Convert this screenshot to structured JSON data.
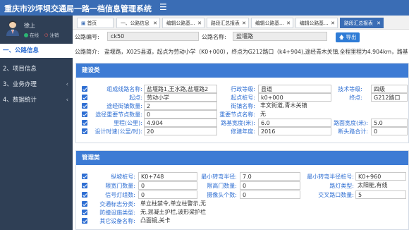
{
  "header": {
    "title": "重庆市沙坪坝交通局一路一档信息管理系统",
    "menu_icon": "menu-icon"
  },
  "user": {
    "name": "徐上",
    "status": "在线",
    "logout": "注销"
  },
  "sidebar": {
    "items": [
      {
        "label": "一、公路信息"
      },
      {
        "label": "2、项目信息"
      },
      {
        "label": "3、业务办理"
      },
      {
        "label": "4、数据统计"
      }
    ]
  },
  "tabs": [
    {
      "label": "首页"
    },
    {
      "label": "一、公路信息"
    },
    {
      "label": "编辑公路基..."
    },
    {
      "label": "路段汇总报表"
    },
    {
      "label": "编辑公路基..."
    },
    {
      "label": "编辑公路基..."
    },
    {
      "label": "路段汇总报表"
    }
  ],
  "info": {
    "code_label": "公路编号:",
    "code_value": "ck50",
    "name_label": "公路名称:",
    "name_value": "盐堰路",
    "export_label": "导出",
    "intro_label": "公路简介:",
    "intro_value": "盐堰路，X025县道，起点为劳动小学（K0+000），终点为G212路口（k4+904),途经青木关镇,全程里程为4.904km，路基"
  },
  "construction": {
    "title": "建设类",
    "fields": {
      "route_name_label": "组成线路名称:",
      "route_name_value": "盐堰路1,王水路,盐堰路2",
      "admin_level_label": "行政等级:",
      "admin_level_value": "县道",
      "tech_level_label": "技术等级:",
      "tech_level_value": "四级",
      "start_label": "起点:",
      "start_value": "劳动小学",
      "start_stake_label": "起点桩号:",
      "start_stake_value": "k0+000",
      "end_label": "终点:",
      "end_value": "G212路口",
      "street_count_label": "途经街镇数量:",
      "street_count_value": "2",
      "street_name_label": "街镇名称:",
      "street_name_value": "丰文街道,青木关镇",
      "key_node_count_label": "途径重要节点数量:",
      "key_node_count_value": "0",
      "key_node_name_label": "重要节点名称:",
      "key_node_name_value": "无",
      "mileage_label": "里程(公里):",
      "mileage_value": "4.904",
      "subgrade_width_label": "路基宽度(米):",
      "subgrade_width_value": "6.0",
      "pavement_width_label": "路面宽度(米):",
      "pavement_width_value": "5.0",
      "design_speed_label": "设计时速(公里/时):",
      "design_speed_value": "20",
      "rebuild_year_label": "修建年度:",
      "rebuild_year_value": "2016",
      "break_mileage_label": "断头路合计:",
      "break_mileage_value": "0"
    }
  },
  "management": {
    "title": "管理类",
    "fields": {
      "slope_stake_label": "纵坡桩号:",
      "slope_stake_value": "K0+748",
      "min_radius_label": "最小转弯半径:",
      "min_radius_value": "7.0",
      "min_radius_stake_label": "最小转弯半径桩号:",
      "min_radius_stake_value": "K0+960",
      "limit_width_label": "限宽门数量:",
      "limit_width_value": "0",
      "limit_height_label": "限高门数量:",
      "limit_height_value": "0",
      "lamp_type_label": "路灯类型:",
      "lamp_type_value": "太阳能,有线",
      "signal_label": "信号灯组数:",
      "signal_value": "0",
      "camera_label": "摄像头个数:",
      "camera_value": "0",
      "crossing_label": "交叉路口数量:",
      "crossing_value": "5",
      "sign_label": "交通标志分类:",
      "sign_value": "单立柱禁令,单立柱警示,无",
      "guard_label": "防撞设施类型:",
      "guard_value": "无,混凝土护栏,波形梁护栏",
      "other_label": "其它设备名称:",
      "other_value": "凸面镜,关卡"
    }
  }
}
